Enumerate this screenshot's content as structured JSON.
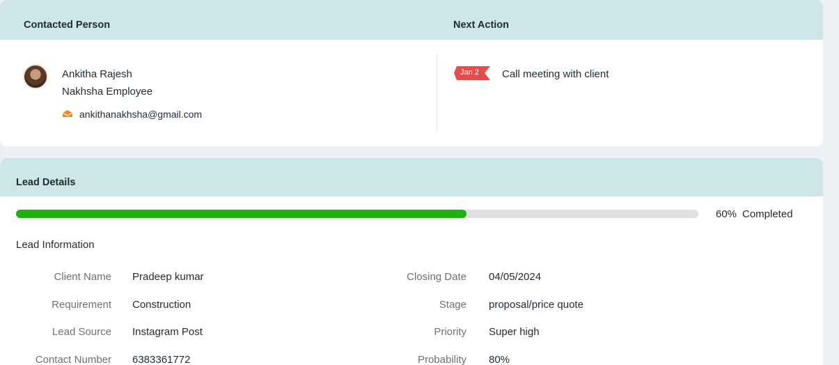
{
  "contacted": {
    "header": "Contacted Person",
    "name": "Ankitha Rajesh",
    "role": "Nakhsha Employee",
    "email": "ankithanakhsha@gmail.com"
  },
  "next_action": {
    "header": "Next Action",
    "date": "Jan 2",
    "text": "Call meeting with client"
  },
  "lead": {
    "header": "Lead Details",
    "progress_fraction": 0.66,
    "progress_pct": "60%",
    "progress_label": "Completed",
    "section_title": "Lead Information",
    "left": [
      {
        "label": "Client Name",
        "value": "Pradeep kumar"
      },
      {
        "label": "Requirement",
        "value": "Construction"
      },
      {
        "label": "Lead Source",
        "value": "Instagram Post"
      },
      {
        "label": "Contact Number",
        "value": "6383361772"
      }
    ],
    "right": [
      {
        "label": "Closing Date",
        "value": "04/05/2024"
      },
      {
        "label": "Stage",
        "value": "proposal/price quote"
      },
      {
        "label": "Priority",
        "value": "Super high"
      },
      {
        "label": "Probability",
        "value": "80%"
      }
    ]
  },
  "colors": {
    "header_bg": "#cde6e8",
    "progress_fill": "#21b014",
    "date_flag": "#e84b4b",
    "email_icon": "#f08a24"
  },
  "icons": {
    "email": "envelope-icon",
    "avatar": "avatar"
  }
}
